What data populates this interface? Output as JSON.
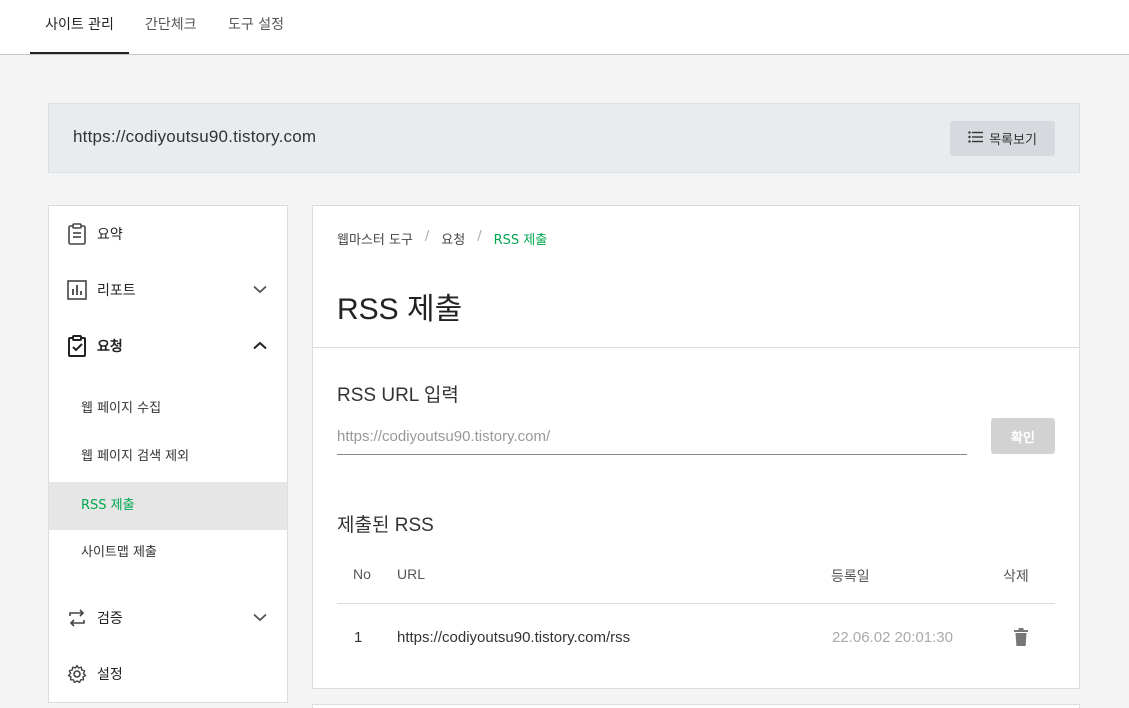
{
  "topnav": {
    "tabs": [
      {
        "label": "사이트 관리",
        "active": true
      },
      {
        "label": "간단체크",
        "active": false
      },
      {
        "label": "도구 설정",
        "active": false
      }
    ]
  },
  "site": {
    "url": "https://codiyoutsu90.tistory.com",
    "list_button": "목록보기",
    "list_icon": "list-icon"
  },
  "sidebar": {
    "items": [
      {
        "label": "요약",
        "icon": "clipboard-icon"
      },
      {
        "label": "리포트",
        "icon": "bar-chart-icon",
        "expanded": false
      },
      {
        "label": "요청",
        "icon": "clipboard-check-icon",
        "expanded": true
      },
      {
        "label": "검증",
        "icon": "repeat-icon",
        "expanded": false
      },
      {
        "label": "설정",
        "icon": "gear-icon"
      }
    ],
    "subitems": [
      {
        "label": "웹 페이지 수집",
        "active": false
      },
      {
        "label": "웹 페이지 검색 제외",
        "active": false
      },
      {
        "label": "RSS 제출",
        "active": true
      },
      {
        "label": "사이트맵 제출",
        "active": false
      }
    ]
  },
  "main": {
    "breadcrumb": [
      "웹마스터 도구",
      "요청",
      "RSS 제출"
    ],
    "breadcrumb_sep": "/",
    "title": "RSS 제출",
    "input_section": {
      "title": "RSS URL 입력",
      "placeholder": "https://codiyoutsu90.tistory.com/",
      "value": "",
      "confirm_label": "확인"
    },
    "submitted": {
      "title": "제출된 RSS",
      "columns": [
        "No",
        "URL",
        "등록일",
        "삭제"
      ],
      "rows": [
        {
          "no": "1",
          "url": "https://codiyoutsu90.tistory.com/rss",
          "date": "22.06.02 20:01:30",
          "delete_icon": "trash-icon"
        }
      ]
    }
  },
  "colors": {
    "accent": "#00a84e",
    "background": "#f4f4f4",
    "sitebar": "#e8ecef",
    "button_disabled": "#d2d2d2"
  }
}
